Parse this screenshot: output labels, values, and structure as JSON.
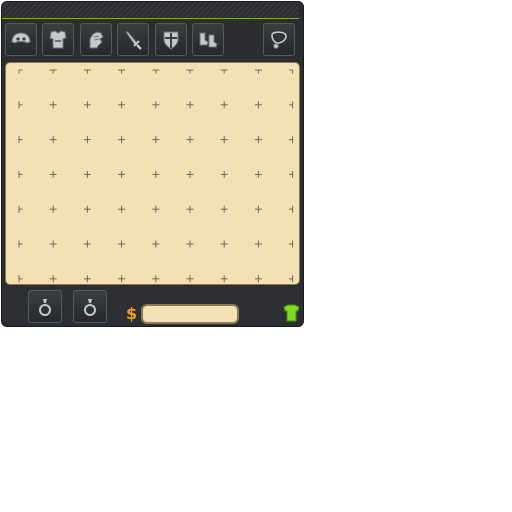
{
  "inventory": {
    "gold_symbol": "$",
    "gold_amount": "",
    "equipment_slots": [
      {
        "name": "helmet-slot",
        "icon": "helmet-icon"
      },
      {
        "name": "armor-slot",
        "icon": "armor-icon"
      },
      {
        "name": "gloves-slot",
        "icon": "gloves-icon"
      },
      {
        "name": "weapon-slot",
        "icon": "sword-icon"
      },
      {
        "name": "shield-slot",
        "icon": "shield-icon"
      },
      {
        "name": "boots-slot",
        "icon": "boots-icon"
      },
      {
        "name": "amulet-slot",
        "icon": "amulet-icon"
      }
    ],
    "ring_slots": [
      {
        "name": "ring-slot-left",
        "icon": "ring-icon"
      },
      {
        "name": "ring-slot-right",
        "icon": "ring-icon"
      }
    ],
    "grid": {
      "columns": 9,
      "rows": 7
    },
    "costume_toggle_icon": "shirt-icon"
  },
  "colors": {
    "panel": "#2b2d30",
    "grid_background": "#f3e0b3",
    "gold_symbol": "#f0a020",
    "accent_green": "#7fa83a",
    "costume_icon": "#7ddc1f"
  }
}
